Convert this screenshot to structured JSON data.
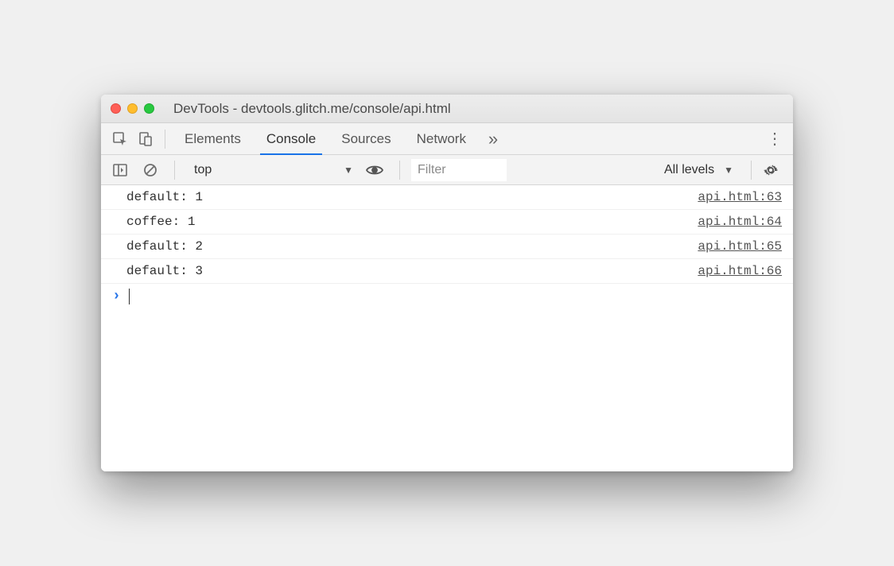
{
  "window": {
    "title": "DevTools - devtools.glitch.me/console/api.html"
  },
  "tabs": [
    {
      "label": "Elements",
      "active": false
    },
    {
      "label": "Console",
      "active": true
    },
    {
      "label": "Sources",
      "active": false
    },
    {
      "label": "Network",
      "active": false
    }
  ],
  "subbar": {
    "context": "top",
    "filter_placeholder": "Filter",
    "levels": "All levels"
  },
  "logs": [
    {
      "message": "default: 1",
      "source": "api.html:63"
    },
    {
      "message": "coffee: 1",
      "source": "api.html:64"
    },
    {
      "message": "default: 2",
      "source": "api.html:65"
    },
    {
      "message": "default: 3",
      "source": "api.html:66"
    }
  ]
}
